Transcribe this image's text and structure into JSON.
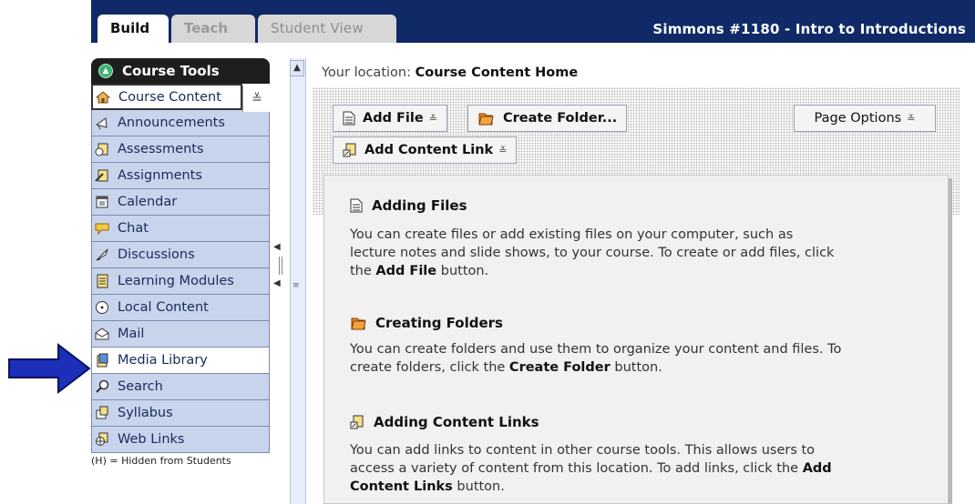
{
  "tabs": [
    {
      "label": "Build"
    },
    {
      "label": "Teach"
    },
    {
      "label": "Student View"
    }
  ],
  "course_title": "Simmons #1180 - Intro to Introductions",
  "sidebar": {
    "header": "Course Tools",
    "items": [
      {
        "label": "Course Content",
        "icon": "home-icon"
      },
      {
        "label": "Announcements",
        "icon": "megaphone-icon"
      },
      {
        "label": "Assessments",
        "icon": "assessment-icon"
      },
      {
        "label": "Assignments",
        "icon": "assignment-icon"
      },
      {
        "label": "Calendar",
        "icon": "calendar-icon"
      },
      {
        "label": "Chat",
        "icon": "chat-icon"
      },
      {
        "label": "Discussions",
        "icon": "discussion-icon"
      },
      {
        "label": "Learning Modules",
        "icon": "module-icon"
      },
      {
        "label": "Local Content",
        "icon": "local-content-icon"
      },
      {
        "label": "Mail",
        "icon": "mail-icon"
      },
      {
        "label": "Media Library",
        "icon": "media-library-icon"
      },
      {
        "label": "Search",
        "icon": "search-icon"
      },
      {
        "label": "Syllabus",
        "icon": "syllabus-icon"
      },
      {
        "label": "Web Links",
        "icon": "web-links-icon"
      }
    ],
    "footer": "(H) = Hidden from Students"
  },
  "main": {
    "location_prefix": "Your location:",
    "location": "Course Content Home",
    "buttons": {
      "add_file": "Add File",
      "create_folder": "Create Folder...",
      "page_options": "Page Options",
      "add_content_link": "Add Content Link"
    },
    "sections": [
      {
        "title": "Adding Files",
        "text_before": "You can create files or add existing files on your computer, such as lecture notes and slide shows, to your course. To create or add files, click the ",
        "bold": "Add File",
        "text_after": " button."
      },
      {
        "title": "Creating Folders",
        "text_before": "You can create folders and use them to organize your content and files. To create folders, click the ",
        "bold": "Create Folder",
        "text_after": " button."
      },
      {
        "title": "Adding Content Links",
        "text_before": "You can add links to content in other course tools. This allows users to access a variety of content from this location. To add links, click the ",
        "bold": "Add Content Links",
        "text_after": " button."
      }
    ]
  },
  "colors": {
    "topbar": "#0f2a66",
    "sidebar_item": "#c8d4ec",
    "arrow": "#1c2fb8"
  }
}
